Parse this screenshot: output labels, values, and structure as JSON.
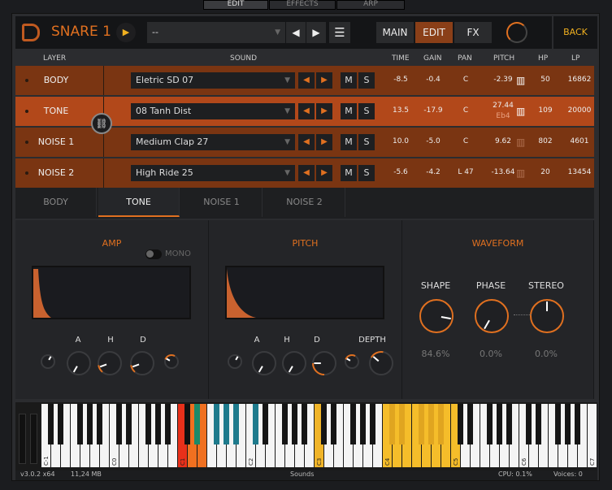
{
  "host": {
    "tabs": [
      "EDIT",
      "EFFECTS",
      "ARP"
    ]
  },
  "header": {
    "title": "SNARE 1",
    "preset": "--",
    "main": "MAIN",
    "edit": "EDIT",
    "fx": "FX",
    "back": "BACK"
  },
  "columns": {
    "layer": "LAYER",
    "sound": "SOUND",
    "time": "TIME",
    "gain": "GAIN",
    "pan": "PAN",
    "pitch": "PITCH",
    "hp": "HP",
    "lp": "LP"
  },
  "layers": [
    {
      "name": "BODY",
      "sound": "Eletric SD 07",
      "time": "-8.5",
      "gain": "-0.4",
      "pan": "C",
      "pitch": "-2.39",
      "note": "",
      "hp": "50",
      "lp": "16862",
      "m": "M",
      "s": "S"
    },
    {
      "name": "TONE",
      "sound": "08 Tanh Dist",
      "time": "13.5",
      "gain": "-17.9",
      "pan": "C",
      "pitch": "27.44",
      "note": "Eb4",
      "hp": "109",
      "lp": "20000",
      "m": "M",
      "s": "S"
    },
    {
      "name": "NOISE 1",
      "sound": "Medium Clap 27",
      "time": "10.0",
      "gain": "-5.0",
      "pan": "C",
      "pitch": "9.62",
      "note": "",
      "hp": "802",
      "lp": "4601",
      "m": "M",
      "s": "S"
    },
    {
      "name": "NOISE 2",
      "sound": "High Ride 25",
      "time": "-5.6",
      "gain": "-4.2",
      "pan": "L 47",
      "pitch": "-13.64",
      "note": "",
      "hp": "20",
      "lp": "13454",
      "m": "M",
      "s": "S"
    }
  ],
  "tabs": [
    "BODY",
    "TONE",
    "NOISE 1",
    "NOISE 2"
  ],
  "amp": {
    "title": "AMP",
    "mono": "MONO",
    "labels": [
      "A",
      "H",
      "D"
    ]
  },
  "pitch": {
    "title": "PITCH",
    "labels": [
      "A",
      "H",
      "D",
      "DEPTH"
    ]
  },
  "waveform": {
    "title": "WAVEFORM",
    "knobs": [
      {
        "label": "SHAPE",
        "value": "84.6%"
      },
      {
        "label": "PHASE",
        "value": "0.0%"
      },
      {
        "label": "STEREO",
        "value": "0.0%"
      }
    ]
  },
  "keyboard": {
    "octave_labels": [
      "C-1",
      "C0",
      "C1",
      "C2",
      "C3",
      "C4",
      "C5",
      "C6",
      "C7"
    ]
  },
  "status": {
    "version": "v3.0.2 x64",
    "memory": "11,24 MB",
    "center": "Sounds",
    "cpu": "CPU: 0.1%",
    "voices": "Voices: 0"
  },
  "colors": {
    "accent": "#e07020",
    "row": "#7a3512",
    "row_selected": "#b2481a"
  }
}
